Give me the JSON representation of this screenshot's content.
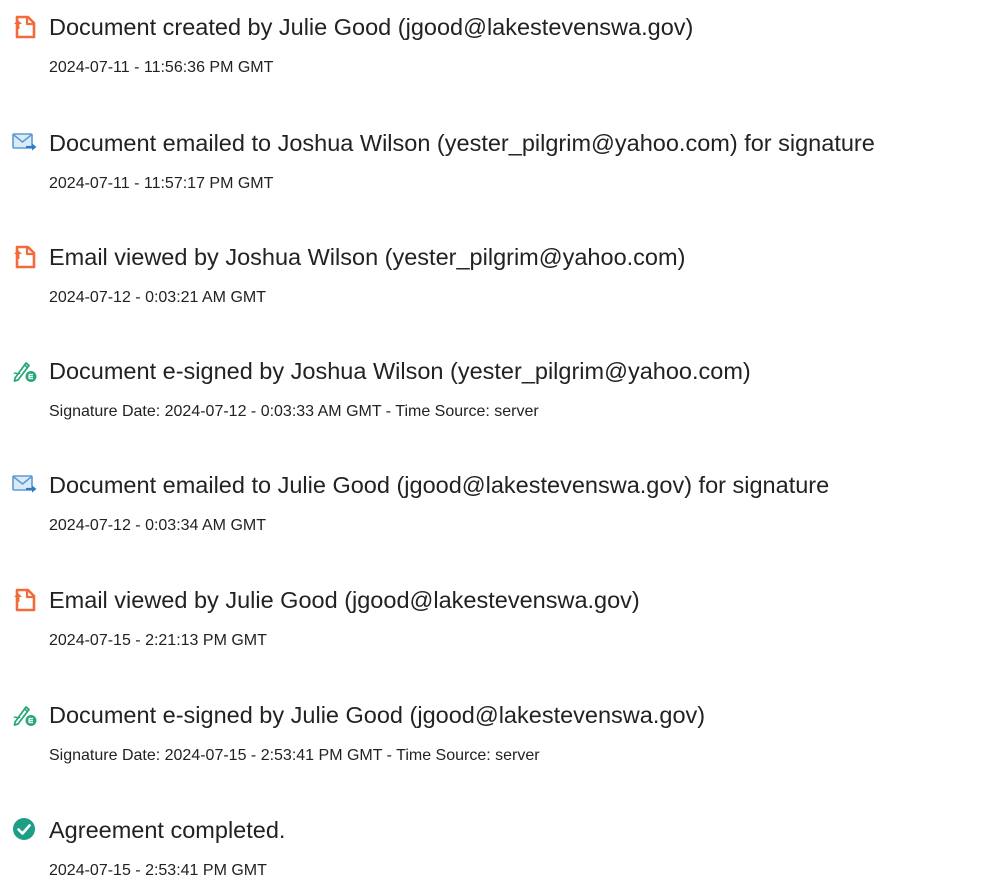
{
  "entries": [
    {
      "icon": "document-created-icon",
      "title": "Document created by Julie Good (jgood@lakestevenswa.gov)",
      "sub": "2024-07-11 - 11:56:36 PM GMT"
    },
    {
      "icon": "email-sent-icon",
      "title": "Document emailed to Joshua Wilson (yester_pilgrim@yahoo.com) for signature",
      "sub": "2024-07-11 - 11:57:17 PM GMT"
    },
    {
      "icon": "email-viewed-icon",
      "title": "Email viewed by Joshua Wilson (yester_pilgrim@yahoo.com)",
      "sub": "2024-07-12 - 0:03:21 AM GMT"
    },
    {
      "icon": "e-sign-icon",
      "title": "Document e-signed by Joshua Wilson (yester_pilgrim@yahoo.com)",
      "sub": "Signature Date: 2024-07-12 - 0:03:33 AM GMT - Time Source: server"
    },
    {
      "icon": "email-sent-icon",
      "title": "Document emailed to Julie Good (jgood@lakestevenswa.gov) for signature",
      "sub": "2024-07-12 - 0:03:34 AM GMT"
    },
    {
      "icon": "email-viewed-icon",
      "title": "Email viewed by Julie Good (jgood@lakestevenswa.gov)",
      "sub": "2024-07-15 - 2:21:13 PM GMT"
    },
    {
      "icon": "e-sign-icon",
      "title": "Document e-signed by Julie Good (jgood@lakestevenswa.gov)",
      "sub": "Signature Date: 2024-07-15 - 2:53:41 PM GMT - Time Source: server"
    },
    {
      "icon": "checkmark-circle-icon",
      "title": "Agreement completed.",
      "sub": "2024-07-15 - 2:53:41 PM GMT"
    }
  ],
  "colors": {
    "document_orange": "#F26B3A",
    "email_blue": "#5B9BD5",
    "email_arrow": "#2E7CC4",
    "sign_green": "#2BA878",
    "check_teal": "#1E9E87"
  }
}
